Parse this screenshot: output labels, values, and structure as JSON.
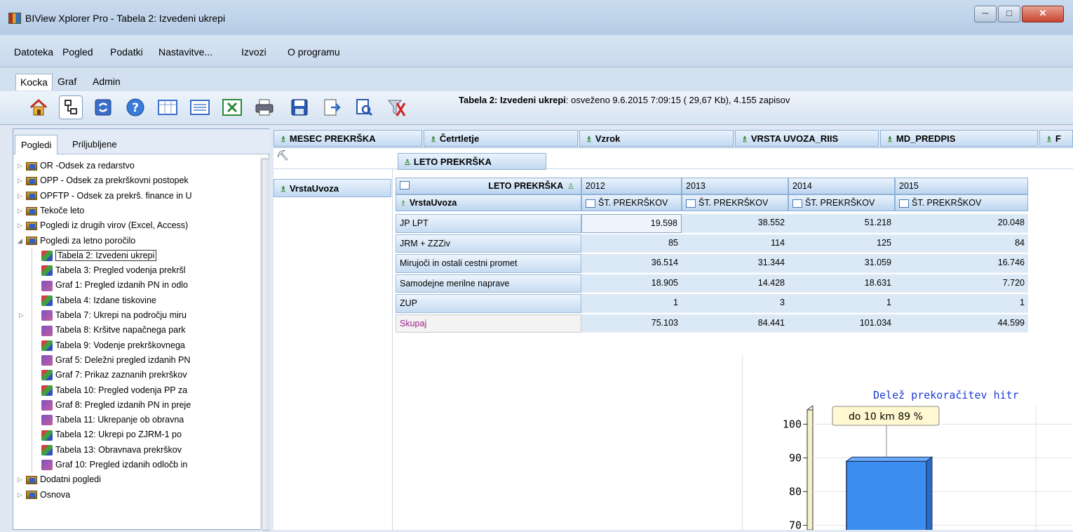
{
  "window": {
    "title": "BIView Xplorer Pro - Tabela 2: Izvedeni ukrepi",
    "min": "─",
    "max": "□",
    "close": "✕"
  },
  "menu": [
    "Datoteka",
    "Pogled",
    "Podatki",
    "Nastavitve...",
    "Izvozi",
    "O programu"
  ],
  "tabs": [
    "Kocka",
    "Graf",
    "Admin"
  ],
  "toolbar": {
    "info_bold": "Tabela 2: Izvedeni ukrepi",
    "info_rest": ": osveženo 9.6.2015 7:09:15 ( 29,67 Kb), 4.155 zapisov"
  },
  "left_tabs": [
    "Pogledi",
    "Priljubljene"
  ],
  "tree": [
    {
      "label": "OR -Odsek za redarstvo",
      "type": "folder",
      "level": 0,
      "arrow": "▷"
    },
    {
      "label": "OPP - Odsek za prekrškovni postopek",
      "type": "folder",
      "level": 0,
      "arrow": "▷"
    },
    {
      "label": "OPFTP - Odsek za prekrš. finance in U",
      "type": "folder",
      "level": 0,
      "arrow": "▷"
    },
    {
      "label": "Tekoče leto",
      "type": "folder",
      "level": 0,
      "arrow": "▷"
    },
    {
      "label": "Pogledi iz drugih virov (Excel, Access)",
      "type": "folder",
      "level": 0,
      "arrow": "▷"
    },
    {
      "label": "Pogledi za letno poročilo",
      "type": "folder",
      "level": 0,
      "arrow": "◢"
    },
    {
      "label": "Tabela 2: Izvedeni ukrepi",
      "type": "cube",
      "level": 1,
      "arrow": "",
      "selected": true
    },
    {
      "label": "Tabela 3: Pregled vodenja prekršl",
      "type": "cube",
      "level": 1,
      "arrow": ""
    },
    {
      "label": "Graf 1: Pregled izdanih PN in odlo",
      "type": "graf",
      "level": 1,
      "arrow": ""
    },
    {
      "label": "Tabela 4: Izdane tiskovine",
      "type": "cube",
      "level": 1,
      "arrow": ""
    },
    {
      "label": "Tabela 7: Ukrepi na področju miru",
      "type": "graf",
      "level": 1,
      "arrow": "▷"
    },
    {
      "label": "Tabela 8: Kršitve napačnega park",
      "type": "graf",
      "level": 1,
      "arrow": ""
    },
    {
      "label": "Tabela 9: Vodenje prekrškovnega",
      "type": "cube",
      "level": 1,
      "arrow": ""
    },
    {
      "label": "Graf 5: Deležni pregled izdanih PN",
      "type": "graf",
      "level": 1,
      "arrow": ""
    },
    {
      "label": "Graf 7: Prikaz zaznanih prekrškov",
      "type": "cube",
      "level": 1,
      "arrow": ""
    },
    {
      "label": "Tabela 10: Pregled vodenja PP za",
      "type": "cube",
      "level": 1,
      "arrow": ""
    },
    {
      "label": "Graf 8: Pregled izdanih PN in preje",
      "type": "graf",
      "level": 1,
      "arrow": ""
    },
    {
      "label": "Tabela 11: Ukrepanje ob obravna",
      "type": "graf",
      "level": 1,
      "arrow": ""
    },
    {
      "label": "Tabela 12: Ukrepi po ZJRM-1 po",
      "type": "cube",
      "level": 1,
      "arrow": ""
    },
    {
      "label": "Tabela 13: Obravnava prekrškov",
      "type": "cube",
      "level": 1,
      "arrow": ""
    },
    {
      "label": "Graf 10: Pregled izdanih odločb in",
      "type": "graf",
      "level": 1,
      "arrow": ""
    },
    {
      "label": "Dodatni pogledi",
      "type": "folder",
      "level": 0,
      "arrow": "▷"
    },
    {
      "label": "Osnova",
      "type": "folder",
      "level": 0,
      "arrow": "▷"
    }
  ],
  "dimensions": [
    "MESEC PREKRŠKA",
    "Četrtletje",
    "Vzrok",
    "VRSTA UVOZA_RIIS",
    "MD_PREDPIS",
    "F"
  ],
  "col_dim": "LETO PREKRŠKA",
  "row_dim": "VrstaUvoza",
  "pivot": {
    "corner_label": "LETO PREKRŠKA",
    "row_header": "VrstaUvoza",
    "years": [
      "2012",
      "2013",
      "2014",
      "2015"
    ],
    "measure": "ŠT. PREKRŠKOV",
    "rows": [
      {
        "label": "JP LPT",
        "values": [
          "19.598",
          "38.552",
          "51.218",
          "20.048"
        ]
      },
      {
        "label": "JRM + ZZZiv",
        "values": [
          "85",
          "114",
          "125",
          "84"
        ]
      },
      {
        "label": "Mirujoči in ostali cestni promet",
        "values": [
          "36.514",
          "31.344",
          "31.059",
          "16.746"
        ]
      },
      {
        "label": "Samodejne merilne naprave",
        "values": [
          "18.905",
          "14.428",
          "18.631",
          "7.720"
        ]
      },
      {
        "label": "ZUP",
        "values": [
          "1",
          "3",
          "1",
          "1"
        ]
      }
    ],
    "total": {
      "label": "Skupaj",
      "values": [
        "75.103",
        "84.441",
        "101.034",
        "44.599"
      ]
    }
  },
  "chart_data": {
    "type": "bar",
    "title": "Delež prekoračitev hitr",
    "categories": [
      "do 10 km"
    ],
    "values": [
      89
    ],
    "tooltip": "do 10 km 89 %",
    "y_ticks": [
      "100",
      "90",
      "80",
      "70"
    ],
    "ylim": [
      65,
      102
    ],
    "colors": {
      "bar": "#3b8ef0",
      "title": "#1a3ad8"
    }
  }
}
